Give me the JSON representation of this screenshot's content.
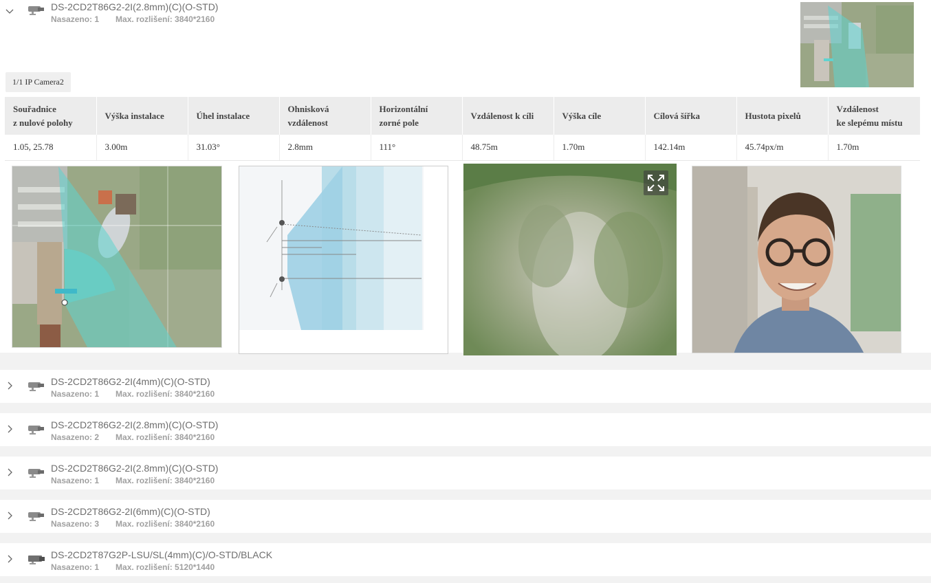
{
  "expanded_device": {
    "title": "DS-2CD2T86G2-2I(2.8mm)(C)(O-STD)",
    "deployed": "Nasazeno: 1",
    "max_resolution": "Max. rozlišení: 3840*2160",
    "camera_tab": "1/1 IP Camera2",
    "table": {
      "headers": [
        [
          "Souřadnice",
          "z nulové polohy"
        ],
        [
          "Výška instalace",
          ""
        ],
        [
          "Úhel instalace",
          ""
        ],
        [
          "Ohnisková",
          "vzdálenost"
        ],
        [
          "Horizontální",
          "zorné pole"
        ],
        [
          "Vzdálenost k cíli",
          ""
        ],
        [
          "Výška cíle",
          ""
        ],
        [
          "Cílová šířka",
          ""
        ],
        [
          "Hustota pixelů",
          ""
        ],
        [
          "Vzdálenost",
          "ke slepému místu"
        ]
      ],
      "values": [
        "1.05, 25.78",
        "3.00m",
        "31.03°",
        "2.8mm",
        "111°",
        "48.75m",
        "1.70m",
        "142.14m",
        "45.74px/m",
        "1.70m"
      ]
    }
  },
  "devices": [
    {
      "title": "DS-2CD2T86G2-2I(4mm)(C)(O-STD)",
      "deployed": "Nasazeno: 1",
      "max_resolution": "Max. rozlišení: 3840*2160"
    },
    {
      "title": "DS-2CD2T86G2-2I(2.8mm)(C)(O-STD)",
      "deployed": "Nasazeno: 2",
      "max_resolution": "Max. rozlišení: 3840*2160"
    },
    {
      "title": "DS-2CD2T86G2-2I(2.8mm)(C)(O-STD)",
      "deployed": "Nasazeno: 1",
      "max_resolution": "Max. rozlišení: 3840*2160"
    },
    {
      "title": "DS-2CD2T86G2-2I(6mm)(C)(O-STD)",
      "deployed": "Nasazeno: 3",
      "max_resolution": "Max. rozlišení: 3840*2160"
    },
    {
      "title": "DS-2CD2T87G2P-LSU/SL(4mm)(C)/O-STD/BLACK",
      "deployed": "Nasazeno: 1",
      "max_resolution": "Max. rozlišení: 5120*1440"
    }
  ],
  "icons": {
    "expand": "chevron-down-icon",
    "collapse": "chevron-right-icon",
    "camera": "bullet-camera-icon",
    "fullscreen": "fullscreen-icon"
  },
  "colors": {
    "fov_overlay": "#5fd3d0",
    "header_bg": "#ececec",
    "meta_text": "#a0a0a0"
  }
}
